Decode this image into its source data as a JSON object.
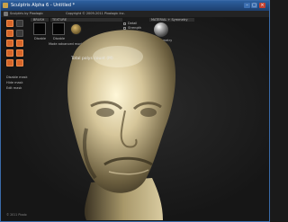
{
  "window": {
    "title": "Sculptris Alpha 6 - Untitled *",
    "minimize_icon": "minimize-icon",
    "maximize_icon": "maximize-icon",
    "close_icon": "close-icon"
  },
  "infostrip": {
    "text1": "Sculptris by Pixologic",
    "text2": "Copyright © 2009-2011 Pixologic Inc."
  },
  "panels": {
    "brush_label": "BRUSH",
    "texture_label": "TEXTURE",
    "material_label": "MATERIAL + Symmetry",
    "brush_swatch_label": "Disable",
    "texture_swatch_label": "Disable",
    "detail_option": "Detail",
    "invert_option": "Invert",
    "strength_option": "Strength",
    "symmetry_option": "Symmetry",
    "options_button": "OPTIONS",
    "mode_label": "Mode advanced mode"
  },
  "sidebar": {
    "items": [
      {
        "label": "Disable mask"
      },
      {
        "label": "Hide mask"
      },
      {
        "label": "Edit mask"
      }
    ]
  },
  "viewport": {
    "overlay_text": "Total polys count (M)"
  },
  "footer": {
    "text": "© 2011 Pixolo"
  },
  "colors": {
    "accent_active": "#d4652a",
    "titlebar": "#2d5f9e",
    "model_skin": "#d6c69a"
  }
}
